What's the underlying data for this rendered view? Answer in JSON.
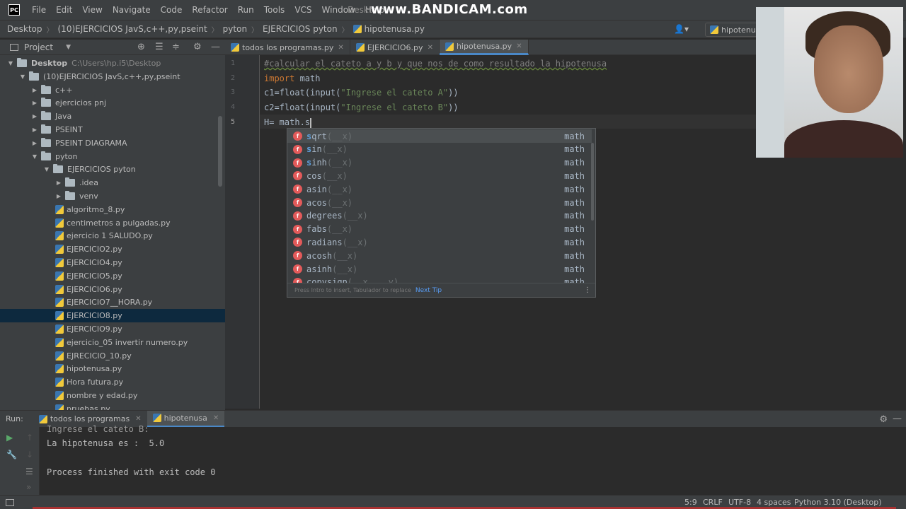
{
  "app": {
    "logo": "PC"
  },
  "menu": [
    "File",
    "Edit",
    "View",
    "Navigate",
    "Code",
    "Refactor",
    "Run",
    "Tools",
    "VCS",
    "Window",
    "Help"
  ],
  "menu_desk": "Deskt",
  "watermark": "www.BANDICAM.com",
  "breadcrumb": [
    "Desktop",
    "(10)EJERCICIOS JavS,c++,py,pseint",
    "pyton",
    "EJERCICIOS pyton",
    "hipotenusa.py"
  ],
  "nav": {
    "user_icon": "user-icon",
    "run_config": "hipotenu"
  },
  "project_panel": {
    "title": "Project",
    "tree": [
      {
        "label": "Desktop",
        "path": "C:\\Users\\hp.i5\\Desktop",
        "type": "folder",
        "expanded": true
      },
      {
        "label": "(10)EJERCICIOS JavS,c++,py,pseint",
        "type": "folder",
        "expanded": true
      },
      {
        "label": "c++",
        "type": "folder",
        "expanded": false
      },
      {
        "label": "ejercicios pnj",
        "type": "folder",
        "expanded": false
      },
      {
        "label": "Java",
        "type": "folder",
        "expanded": false
      },
      {
        "label": "PSEINT",
        "type": "folder",
        "expanded": false
      },
      {
        "label": "PSEINT DIAGRAMA",
        "type": "folder",
        "expanded": false
      },
      {
        "label": "pyton",
        "type": "folder",
        "expanded": true
      },
      {
        "label": "EJERCICIOS pyton",
        "type": "folder",
        "expanded": true
      },
      {
        "label": ".idea",
        "type": "folder",
        "expanded": false
      },
      {
        "label": "venv",
        "type": "folder",
        "expanded": false
      },
      {
        "label": "algoritmo_8.py",
        "type": "file"
      },
      {
        "label": "centimetros a pulgadas.py",
        "type": "file"
      },
      {
        "label": "ejercicio 1 SALUDO.py",
        "type": "file"
      },
      {
        "label": "EJERCICIO2.py",
        "type": "file"
      },
      {
        "label": "EJERCICIO4.py",
        "type": "file"
      },
      {
        "label": "EJERCICIO5.py",
        "type": "file"
      },
      {
        "label": "EJERCICIO6.py",
        "type": "file"
      },
      {
        "label": "EJERCICIO7__HORA.py",
        "type": "file"
      },
      {
        "label": "EJERCICIO8.py",
        "type": "file",
        "selected": true
      },
      {
        "label": "EJERCICIO9.py",
        "type": "file"
      },
      {
        "label": "ejercicio_05 invertir numero.py",
        "type": "file"
      },
      {
        "label": "EJRECICIO_10.py",
        "type": "file"
      },
      {
        "label": "hipotenusa.py",
        "type": "file"
      },
      {
        "label": "Hora futura.py",
        "type": "file"
      },
      {
        "label": "nombre y edad.py",
        "type": "file"
      },
      {
        "label": "pruebas.py",
        "type": "file"
      }
    ]
  },
  "editor_tabs": [
    {
      "label": "todos los programas.py",
      "active": false
    },
    {
      "label": "EJERCICIO6.py",
      "active": false
    },
    {
      "label": "hipotenusa.py",
      "active": true
    }
  ],
  "code": {
    "line_numbers": [
      "1",
      "2",
      "3",
      "4",
      "5"
    ],
    "line1": "#calcular el cateto a y b y que nos de como resultado la hipotenusa",
    "line2_kw": "import",
    "line2_rest": " math",
    "line3_a": "c1=float(input(",
    "line3_str": "\"Ingrese el cateto A\"",
    "line3_b": "))",
    "line4_a": "c2=float(input(",
    "line4_str": "\"Ingrese el cateto B\"",
    "line4_b": "))",
    "line5": "H= math.s"
  },
  "autocomplete": {
    "items": [
      {
        "badge": "f",
        "match": "s",
        "name": "qrt",
        "params": "(__x)",
        "type": "math"
      },
      {
        "badge": "f",
        "match": "s",
        "name": "in",
        "params": "(__x)",
        "type": "math"
      },
      {
        "badge": "f",
        "match": "s",
        "name": "inh",
        "params": "(__x)",
        "type": "math"
      },
      {
        "badge": "f",
        "match": "",
        "name": "cos",
        "params": "(__x)",
        "type": "math"
      },
      {
        "badge": "f",
        "match": "",
        "name": "asin",
        "params": "(__x)",
        "type": "math"
      },
      {
        "badge": "f",
        "match": "",
        "name": "acos",
        "params": "(__x)",
        "type": "math"
      },
      {
        "badge": "f",
        "match": "",
        "name": "degrees",
        "params": "(__x)",
        "type": "math"
      },
      {
        "badge": "f",
        "match": "",
        "name": "fabs",
        "params": "(__x)",
        "type": "math"
      },
      {
        "badge": "f",
        "match": "",
        "name": "radians",
        "params": "(__x)",
        "type": "math"
      },
      {
        "badge": "f",
        "match": "",
        "name": "acosh",
        "params": "(__x)",
        "type": "math"
      },
      {
        "badge": "f",
        "match": "",
        "name": "asinh",
        "params": "(__x)",
        "type": "math"
      },
      {
        "badge": "f",
        "match": "",
        "name": "copysign",
        "params": "(__x, __y)",
        "type": "math"
      }
    ],
    "hint": "Press Intro to insert, Tabulador to replace",
    "next_tip": "Next Tip"
  },
  "run_panel": {
    "label": "Run:",
    "tabs": [
      {
        "label": "todos los programas",
        "active": false
      },
      {
        "label": "hipotenusa",
        "active": true
      }
    ],
    "output": [
      "Ingrese el cateto B:",
      "La hipotenusa es :  5.0",
      "",
      "Process finished with exit code 0"
    ]
  },
  "status": {
    "position": "5:9",
    "line_sep": "CRLF",
    "encoding": "UTF-8",
    "indent": "4 spaces",
    "interpreter": "Python 3.10 (Desktop)"
  },
  "colors": {
    "accent": "#4a88c7",
    "selection": "#0d293e",
    "keyword": "#cc7832",
    "string": "#6a8759",
    "comment": "#808080"
  }
}
